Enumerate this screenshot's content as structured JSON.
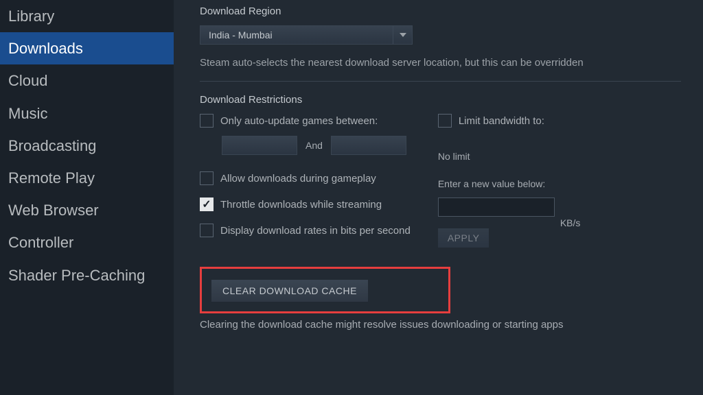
{
  "sidebar": {
    "items": [
      {
        "label": "Library",
        "selected": false
      },
      {
        "label": "Downloads",
        "selected": true
      },
      {
        "label": "Cloud",
        "selected": false
      },
      {
        "label": "Music",
        "selected": false
      },
      {
        "label": "Broadcasting",
        "selected": false
      },
      {
        "label": "Remote Play",
        "selected": false
      },
      {
        "label": "Web Browser",
        "selected": false
      },
      {
        "label": "Controller",
        "selected": false
      },
      {
        "label": "Shader Pre-Caching",
        "selected": false
      }
    ]
  },
  "main": {
    "region_title": "Download Region",
    "region_value": "India - Mumbai",
    "region_desc": "Steam auto-selects the nearest download server location, but this can be overridden",
    "restrictions_title": "Download Restrictions",
    "auto_update_label": "Only auto-update games between:",
    "and_label": "And",
    "allow_gameplay_label": "Allow downloads during gameplay",
    "throttle_label": "Throttle downloads while streaming",
    "display_bits_label": "Display download rates in bits per second",
    "limit_bw_label": "Limit bandwidth to:",
    "no_limit_label": "No limit",
    "enter_value_label": "Enter a new value below:",
    "kbs_label": "KB/s",
    "apply_label": "APPLY",
    "clear_cache_label": "CLEAR DOWNLOAD CACHE",
    "cache_desc": "Clearing the download cache might resolve issues downloading or starting apps"
  },
  "checkboxes": {
    "auto_update": false,
    "allow_gameplay": false,
    "throttle": true,
    "display_bits": false,
    "limit_bw": false
  }
}
